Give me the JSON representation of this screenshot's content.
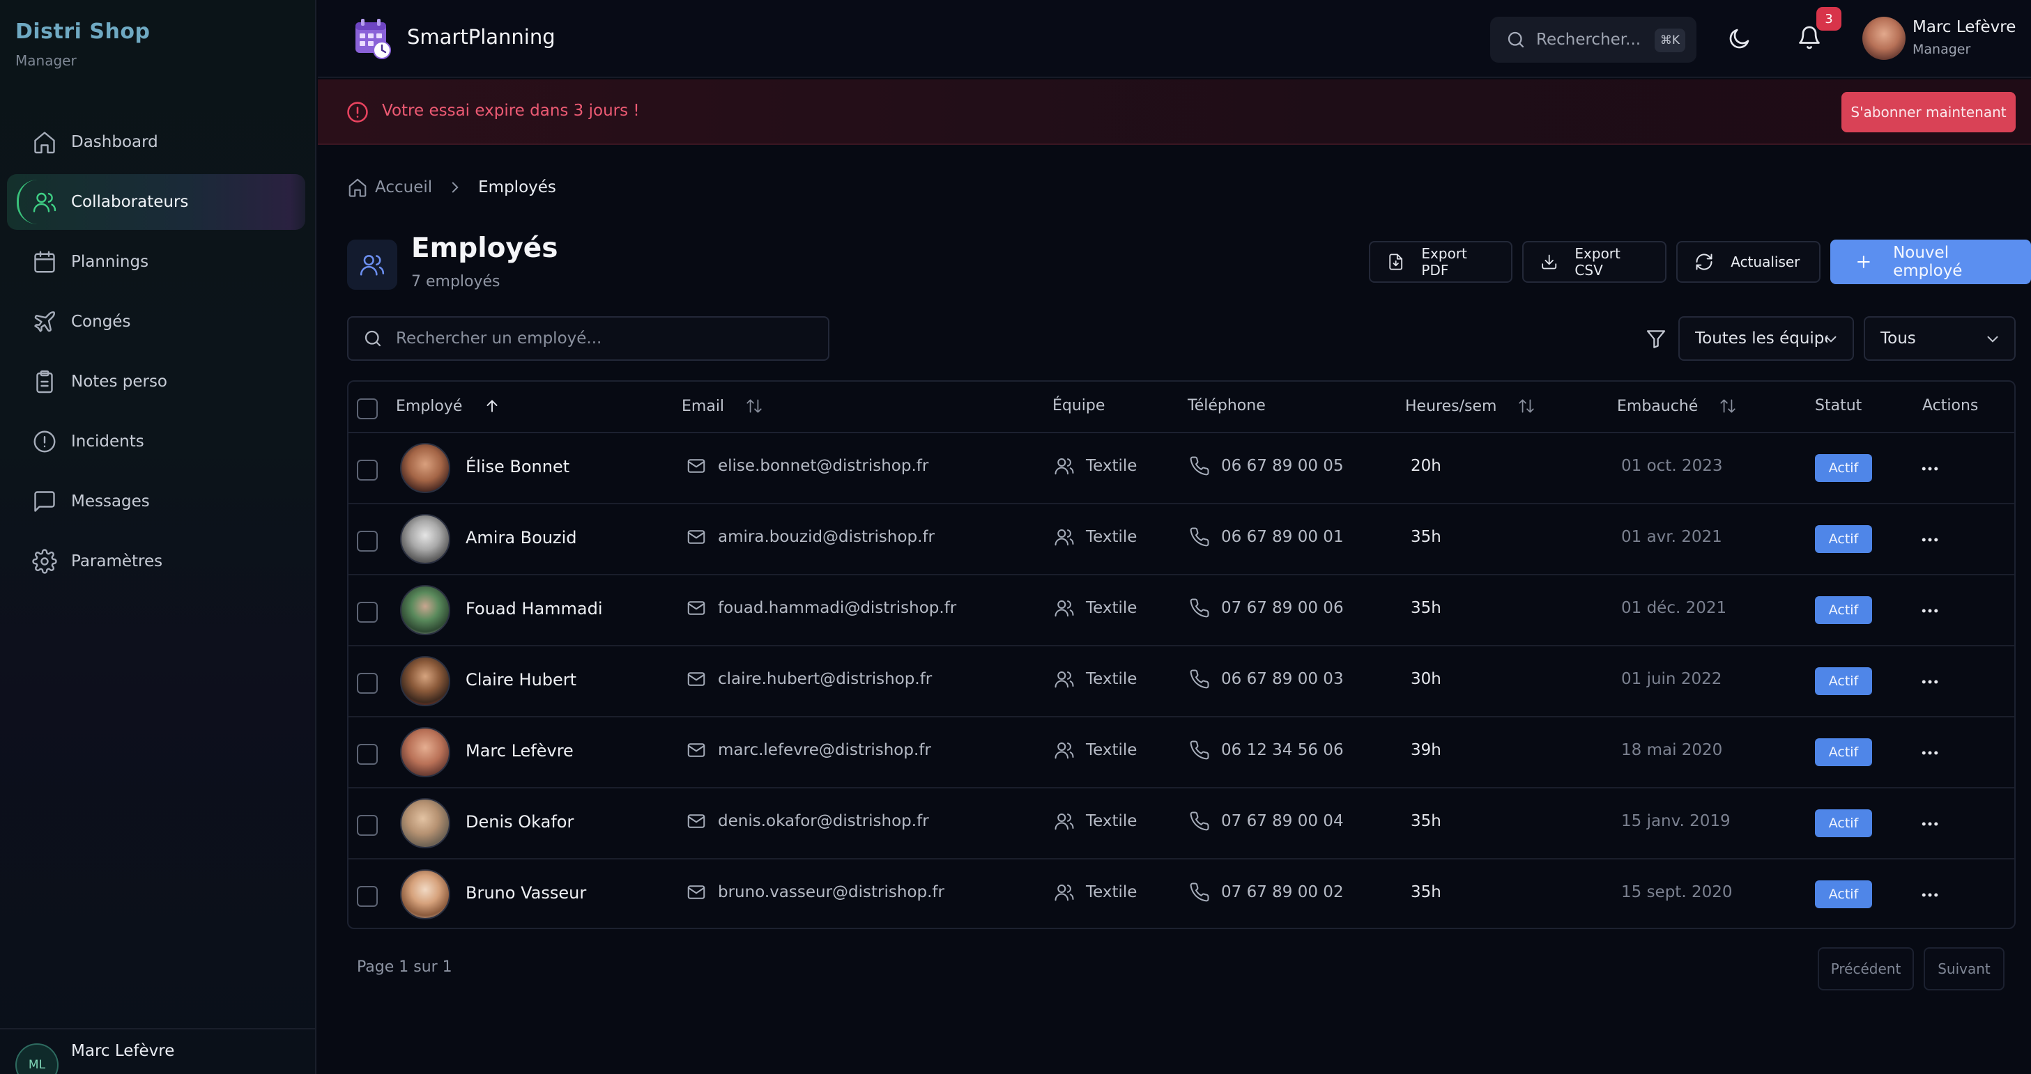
{
  "sidebar": {
    "brand": "Distri Shop",
    "role": "Manager",
    "items": [
      {
        "label": "Dashboard",
        "icon": "home-icon"
      },
      {
        "label": "Collaborateurs",
        "icon": "users-icon",
        "active": true
      },
      {
        "label": "Plannings",
        "icon": "calendar-icon"
      },
      {
        "label": "Congés",
        "icon": "plane-icon"
      },
      {
        "label": "Notes perso",
        "icon": "clipboard-icon"
      },
      {
        "label": "Incidents",
        "icon": "alert-circle-icon"
      },
      {
        "label": "Messages",
        "icon": "message-icon"
      },
      {
        "label": "Paramètres",
        "icon": "gear-icon"
      }
    ],
    "user": {
      "initials": "ML",
      "name": "Marc Lefèvre"
    }
  },
  "header": {
    "app_name": "SmartPlanning",
    "search_placeholder": "Rechercher...",
    "search_shortcut": "⌘K",
    "notification_count": "3",
    "user_name": "Marc Lefèvre",
    "user_role": "Manager"
  },
  "banner": {
    "text": "Votre essai expire dans 3 jours !",
    "button": "S'abonner maintenant"
  },
  "breadcrumb": {
    "home": "Accueil",
    "current": "Employés"
  },
  "page": {
    "title": "Employés",
    "subtitle": "7 employés",
    "buttons": {
      "export_pdf": "Export PDF",
      "export_csv": "Export CSV",
      "refresh": "Actualiser",
      "new_employee": "Nouvel employé"
    }
  },
  "filters": {
    "search_placeholder": "Rechercher un employé...",
    "team": "Toutes les équipes",
    "status": "Tous"
  },
  "table": {
    "columns": {
      "employee": "Employé",
      "email": "Email",
      "team": "Équipe",
      "phone": "Téléphone",
      "hours": "Heures/sem",
      "hired": "Embauché",
      "status": "Statut",
      "actions": "Actions"
    },
    "rows": [
      {
        "name": "Élise Bonnet",
        "email": "elise.bonnet@distrishop.fr",
        "team": "Textile",
        "phone": "06 67 89 00 05",
        "hours": "20h",
        "hired": "01 oct. 2023",
        "status": "Actif"
      },
      {
        "name": "Amira Bouzid",
        "email": "amira.bouzid@distrishop.fr",
        "team": "Textile",
        "phone": "06 67 89 00 01",
        "hours": "35h",
        "hired": "01 avr. 2021",
        "status": "Actif"
      },
      {
        "name": "Fouad Hammadi",
        "email": "fouad.hammadi@distrishop.fr",
        "team": "Textile",
        "phone": "07 67 89 00 06",
        "hours": "35h",
        "hired": "01 déc. 2021",
        "status": "Actif"
      },
      {
        "name": "Claire Hubert",
        "email": "claire.hubert@distrishop.fr",
        "team": "Textile",
        "phone": "06 67 89 00 03",
        "hours": "30h",
        "hired": "01 juin 2022",
        "status": "Actif"
      },
      {
        "name": "Marc Lefèvre",
        "email": "marc.lefevre@distrishop.fr",
        "team": "Textile",
        "phone": "06 12 34 56 06",
        "hours": "39h",
        "hired": "18 mai 2020",
        "status": "Actif"
      },
      {
        "name": "Denis Okafor",
        "email": "denis.okafor@distrishop.fr",
        "team": "Textile",
        "phone": "07 67 89 00 04",
        "hours": "35h",
        "hired": "15 janv. 2019",
        "status": "Actif"
      },
      {
        "name": "Bruno Vasseur",
        "email": "bruno.vasseur@distrishop.fr",
        "team": "Textile",
        "phone": "07 67 89 00 02",
        "hours": "35h",
        "hired": "15 sept. 2020",
        "status": "Actif"
      }
    ]
  },
  "pagination": {
    "info": "Page 1 sur 1",
    "prev": "Précédent",
    "next": "Suivant"
  },
  "colors": {
    "accent": "#5b8ff0",
    "active_nav": "#3fcf85",
    "danger": "#d94256",
    "status_active": "#4f86e8"
  }
}
